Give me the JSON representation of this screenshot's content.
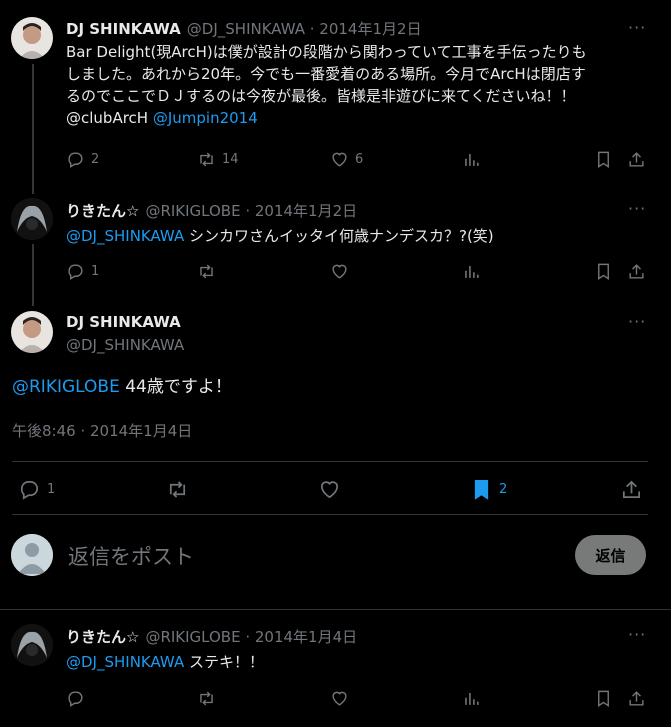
{
  "tweet1": {
    "name": "DJ SHINKAWA",
    "meta": "@DJ_SHINKAWA · 2014年1月2日",
    "line1": "Bar Delight(現ArcH)は僕が設計の段階から関わっていて工事を手伝ったりも",
    "line2": "しました。あれから20年。今でも一番愛着のある場所。今月でArcHは閉店す",
    "line3": "るのでここでＤＪするのは今夜が最後。皆様是非遊びに来てくださいね！！",
    "line4_text": "@clubArcH ",
    "line4_link": "@Jumpin2014",
    "replies": "2",
    "retweets": "14",
    "likes": "6"
  },
  "tweet2": {
    "name": "りきたん☆",
    "meta": "@RIKIGLOBE · 2014年1月2日",
    "mention": "@DJ_SHINKAWA",
    "text": " シンカワさんイッタイ何歳ナンデスカ？?(笑)",
    "replies": "1"
  },
  "main": {
    "name": "DJ SHINKAWA",
    "handle": "@DJ_SHINKAWA",
    "mention": "@RIKIGLOBE",
    "text": " 44歳ですよ！",
    "timestamp": "午後8:46 · 2014年1月4日",
    "replies": "1",
    "bookmarks": "2"
  },
  "composer": {
    "placeholder": "返信をポスト",
    "button": "返信"
  },
  "tweet3": {
    "name": "りきたん☆",
    "meta": "@RIKIGLOBE · 2014年1月4日",
    "mention": "@DJ_SHINKAWA",
    "text": " ステキ！！"
  },
  "icons": {
    "more": "more-icon",
    "reply": "reply-icon",
    "retweet": "retweet-icon",
    "like": "heart-icon",
    "views": "views-icon",
    "bookmark": "bookmark-icon",
    "share": "share-icon"
  },
  "colors": {
    "accent": "#1d9bf0",
    "muted": "#71767b",
    "background": "#000000"
  }
}
